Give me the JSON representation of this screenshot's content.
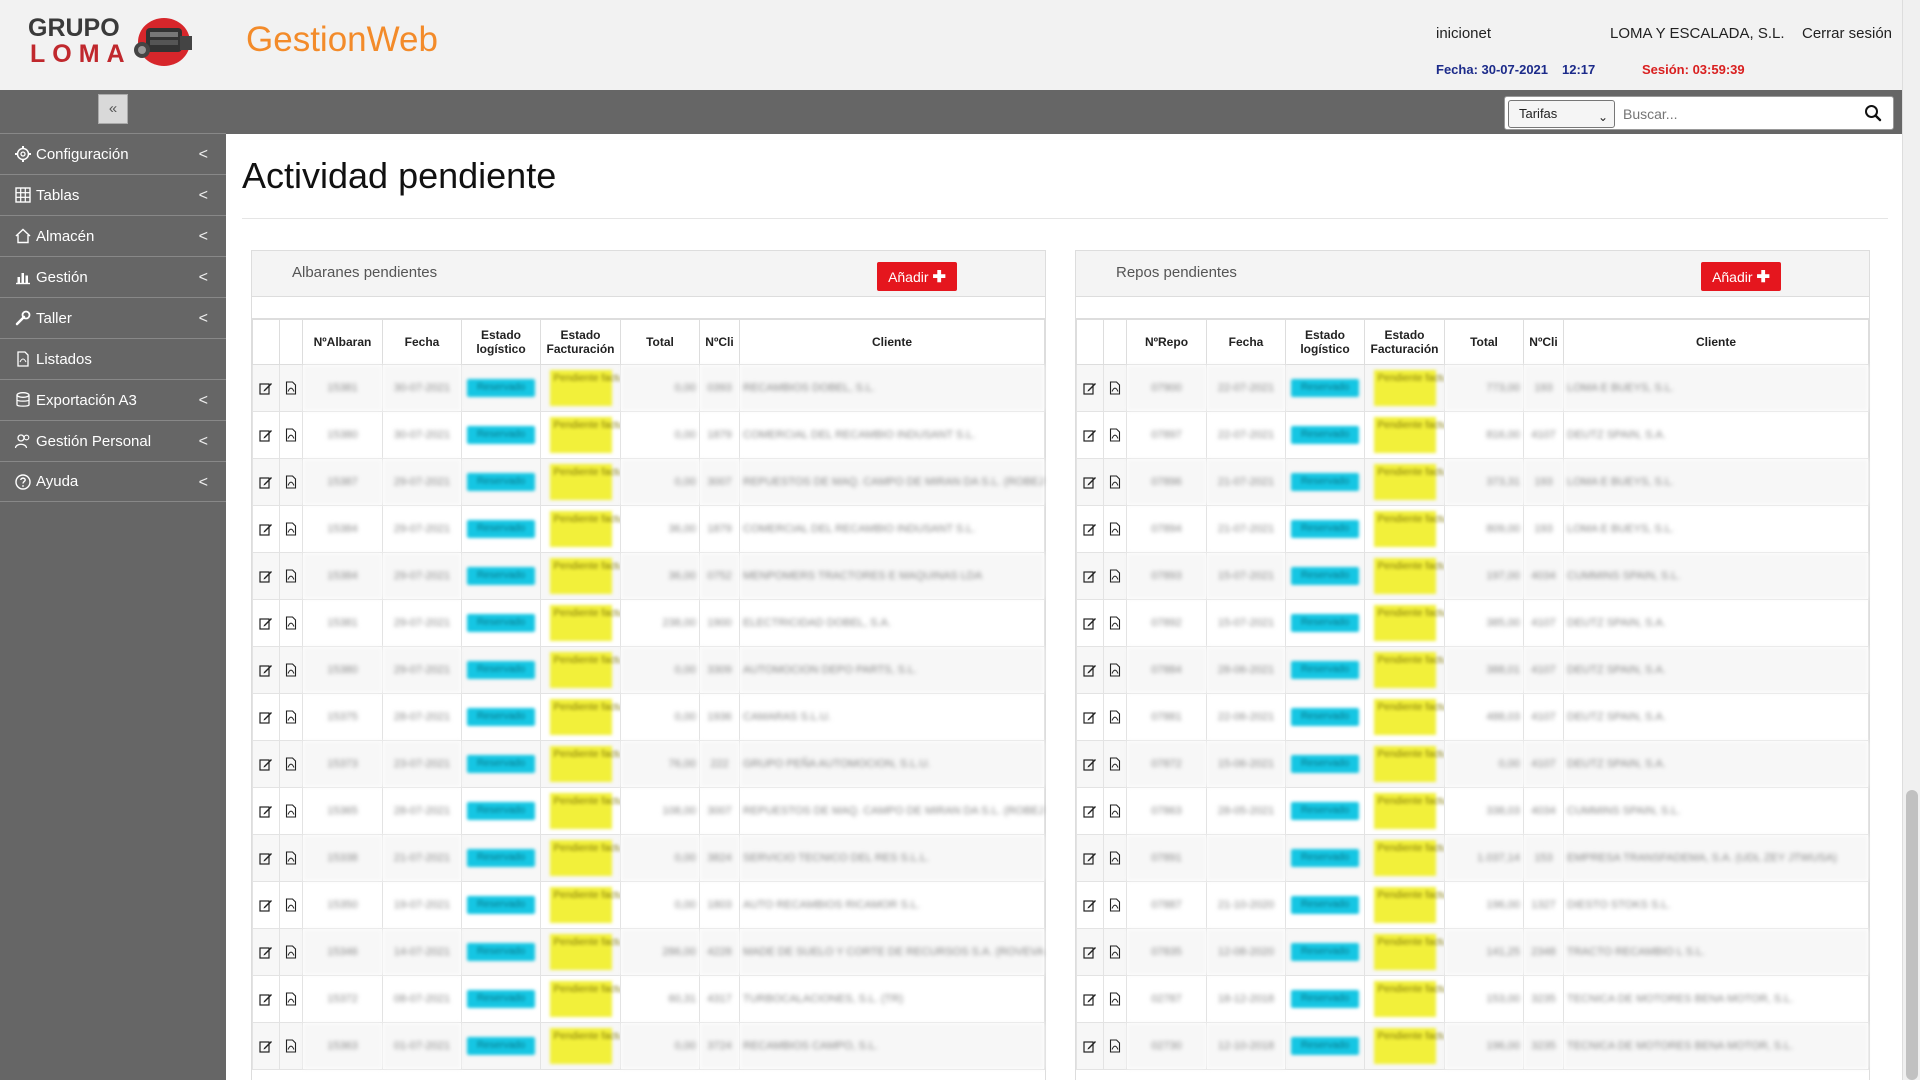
{
  "header": {
    "logo_line1": "GRUPO",
    "logo_line2": "LOMA",
    "app_title": "GestionWeb",
    "user": "inicionet",
    "company": "LOMA Y ESCALADA, S.L.",
    "logout_label": "Cerrar sesión",
    "date_label": "Fecha: 30-07-2021",
    "time_label": "12:17",
    "session_label": "Sesión: 03:59:39"
  },
  "sidebar": {
    "toggle_label": "«",
    "items": [
      {
        "label": "Configuración",
        "icon": "gear-icon",
        "has_chevron": true
      },
      {
        "label": "Tablas",
        "icon": "table-icon",
        "has_chevron": true
      },
      {
        "label": "Almacén",
        "icon": "home-icon",
        "has_chevron": true
      },
      {
        "label": "Gestión",
        "icon": "bar-chart-icon",
        "has_chevron": true
      },
      {
        "label": "Taller",
        "icon": "wrench-icon",
        "has_chevron": true
      },
      {
        "label": "Listados",
        "icon": "pdf-icon",
        "has_chevron": false
      },
      {
        "label": "Exportación A3",
        "icon": "database-icon",
        "has_chevron": true
      },
      {
        "label": "Gestión Personal",
        "icon": "users-icon",
        "has_chevron": true
      },
      {
        "label": "Ayuda",
        "icon": "help-icon",
        "has_chevron": true
      }
    ],
    "chevron": "<"
  },
  "toolbar": {
    "category_selected": "Tarifas",
    "search_placeholder": "Buscar..."
  },
  "main": {
    "page_title": "Actividad pendiente"
  },
  "colors": {
    "accent_orange": "#f38b2a",
    "add_button_red": "#e5161e",
    "logistic_badge": "#15c6e3",
    "billing_badge": "#f2f03a"
  },
  "albaranes": {
    "title": "Albaranes pendientes",
    "add_label": "Añadir",
    "columns": [
      "NºAlbaran",
      "Fecha",
      "Estado logístico",
      "Estado Facturación",
      "Total",
      "NºCli",
      "Cliente"
    ],
    "rows": [
      {
        "num": "15381",
        "fecha": "30-07-2021",
        "log": "Reservado",
        "fac": "Pendiente facturar",
        "total": "0,00",
        "cli": "0393",
        "cliente": "RECAMBIOS DOBEL, S.L."
      },
      {
        "num": "15380",
        "fecha": "30-07-2021",
        "log": "Reservado",
        "fac": "Pendiente facturar",
        "total": "0,00",
        "cli": "1879",
        "cliente": "COMERCIAL DEL RECAMBIO INDUSANT S.L."
      },
      {
        "num": "15387",
        "fecha": "29-07-2021",
        "log": "Reservado",
        "fac": "Pendiente facturar",
        "total": "0,00",
        "cli": "3007",
        "cliente": "REPUESTOS DE MAQ. CAMPO DE MIRAN DA S.L. (ROBEJAS)"
      },
      {
        "num": "15384",
        "fecha": "29-07-2021",
        "log": "Reservado",
        "fac": "Pendiente facturar",
        "total": "36,00",
        "cli": "1879",
        "cliente": "COMERCIAL DEL RECAMBIO INDUSANT S.L."
      },
      {
        "num": "15384",
        "fecha": "29-07-2021",
        "log": "Reservado",
        "fac": "Pendiente facturar",
        "total": "36,00",
        "cli": "0752",
        "cliente": "MENPOMERS TRACTORES E MAQUINAS LDA"
      },
      {
        "num": "15381",
        "fecha": "29-07-2021",
        "log": "Reservado",
        "fac": "Pendiente facturar",
        "total": "238,00",
        "cli": "1900",
        "cliente": "ELECTRICIDAD DOBEL, S.A."
      },
      {
        "num": "15380",
        "fecha": "29-07-2021",
        "log": "Reservado",
        "fac": "Pendiente facturar",
        "total": "0,00",
        "cli": "3309",
        "cliente": "AUTOMOCION DEPO PARTS, S.L."
      },
      {
        "num": "15375",
        "fecha": "28-07-2021",
        "log": "Reservado",
        "fac": "Pendiente facturar",
        "total": "0,00",
        "cli": "1936",
        "cliente": "CAMARAS S.L.U."
      },
      {
        "num": "15373",
        "fecha": "23-07-2021",
        "log": "Reservado",
        "fac": "Pendiente facturar",
        "total": "76,00",
        "cli": "222",
        "cliente": "GRUPO PEÑA AUTOMOCION, S.L.U."
      },
      {
        "num": "15365",
        "fecha": "28-07-2021",
        "log": "Reservado",
        "fac": "Pendiente facturar",
        "total": "108,00",
        "cli": "3007",
        "cliente": "REPUESTOS DE MAQ. CAMPO DE MIRAN DA S.L. (ROBEJAS)"
      },
      {
        "num": "15338",
        "fecha": "21-07-2021",
        "log": "Reservado",
        "fac": "Pendiente facturar",
        "total": "0,00",
        "cli": "3824",
        "cliente": "SERVICIO TECNICO DEL RES S.L.L."
      },
      {
        "num": "15350",
        "fecha": "19-07-2021",
        "log": "Reservado",
        "fac": "Pendiente facturar",
        "total": "0,00",
        "cli": "1803",
        "cliente": "AUTO RECAMBIOS RICAMOR S.L."
      },
      {
        "num": "15346",
        "fecha": "14-07-2021",
        "log": "Reservado",
        "fac": "Pendiente facturar",
        "total": "286,00",
        "cli": "4228",
        "cliente": "MADE DE SUELO Y CORTE DE RECURSOS S.A. (ROVEVA)"
      },
      {
        "num": "15372",
        "fecha": "08-07-2021",
        "log": "Reservado",
        "fac": "Pendiente facturar",
        "total": "60,31",
        "cli": "4317",
        "cliente": "TURBOCALACIONES, S.L. (TR)"
      },
      {
        "num": "15363",
        "fecha": "01-07-2021",
        "log": "Reservado",
        "fac": "Pendiente facturar",
        "total": "0,00",
        "cli": "3724",
        "cliente": "RECAMBIOS CAMPO, S.L."
      }
    ]
  },
  "repos": {
    "title": "Repos pendientes",
    "add_label": "Añadir",
    "columns": [
      "NºRepo",
      "Fecha",
      "Estado logístico",
      "Estado Facturación",
      "Total",
      "NºCli",
      "Cliente"
    ],
    "rows": [
      {
        "num": "07900",
        "fecha": "22-07-2021",
        "log": "Reservado",
        "fac": "Pendiente facturar",
        "total": "773,00",
        "cli": "193",
        "cliente": "LOMA E BUEYS, S.L."
      },
      {
        "num": "07897",
        "fecha": "22-07-2021",
        "log": "Reservado",
        "fac": "Pendiente facturar",
        "total": "816,00",
        "cli": "4107",
        "cliente": "DEUTZ SPAIN, S.A."
      },
      {
        "num": "07896",
        "fecha": "21-07-2021",
        "log": "Reservado",
        "fac": "Pendiente facturar",
        "total": "373,31",
        "cli": "193",
        "cliente": "LOMA E BUEYS, S.L."
      },
      {
        "num": "07894",
        "fecha": "21-07-2021",
        "log": "Reservado",
        "fac": "Pendiente facturar",
        "total": "809,00",
        "cli": "193",
        "cliente": "LOMA E BUEYS, S.L."
      },
      {
        "num": "07893",
        "fecha": "15-07-2021",
        "log": "Reservado",
        "fac": "Pendiente facturar",
        "total": "197,00",
        "cli": "4034",
        "cliente": "CUMMINS SPAIN, S.L."
      },
      {
        "num": "07892",
        "fecha": "15-07-2021",
        "log": "Reservado",
        "fac": "Pendiente facturar",
        "total": "385,00",
        "cli": "4107",
        "cliente": "DEUTZ SPAIN, S.A."
      },
      {
        "num": "07884",
        "fecha": "28-06-2021",
        "log": "Reservado",
        "fac": "Pendiente facturar",
        "total": "388,01",
        "cli": "4107",
        "cliente": "DEUTZ SPAIN, S.A."
      },
      {
        "num": "07881",
        "fecha": "22-06-2021",
        "log": "Reservado",
        "fac": "Pendiente facturar",
        "total": "488,03",
        "cli": "4107",
        "cliente": "DEUTZ SPAIN, S.A."
      },
      {
        "num": "07872",
        "fecha": "15-06-2021",
        "log": "Reservado",
        "fac": "Pendiente facturar",
        "total": "0,00",
        "cli": "4107",
        "cliente": "DEUTZ SPAIN, S.A."
      },
      {
        "num": "07863",
        "fecha": "28-05-2021",
        "log": "Reservado",
        "fac": "Pendiente facturar",
        "total": "338,03",
        "cli": "4034",
        "cliente": "CUMMINS SPAIN, S.L."
      },
      {
        "num": "07891",
        "fecha": "",
        "log": "Reservado",
        "fac": "Pendiente facturar",
        "total": "1.037,14",
        "cli": "153",
        "cliente": "EMPRESA TRANSFADEMA, S.A. (UDL ZEY JTWUSA)"
      },
      {
        "num": "07887",
        "fecha": "21-10-2020",
        "log": "Reservado",
        "fac": "Pendiente facturar",
        "total": "196,00",
        "cli": "1327",
        "cliente": "DIESTO STOKS S.L."
      },
      {
        "num": "07835",
        "fecha": "12-08-2020",
        "log": "Reservado",
        "fac": "Pendiente facturar",
        "total": "141,25",
        "cli": "2348",
        "cliente": "TRACTO RECAMBIO L S.L."
      },
      {
        "num": "02787",
        "fecha": "18-12-2018",
        "log": "Reservado",
        "fac": "Pendiente facturar",
        "total": "153,00",
        "cli": "3235",
        "cliente": "TECNICA DE MOTORES BENA MOTOR, S.L."
      },
      {
        "num": "02730",
        "fecha": "12-10-2018",
        "log": "Reservado",
        "fac": "Pendiente facturar",
        "total": "196,00",
        "cli": "3235",
        "cliente": "TECNICA DE MOTORES BENA MOTOR, S.L."
      }
    ]
  }
}
